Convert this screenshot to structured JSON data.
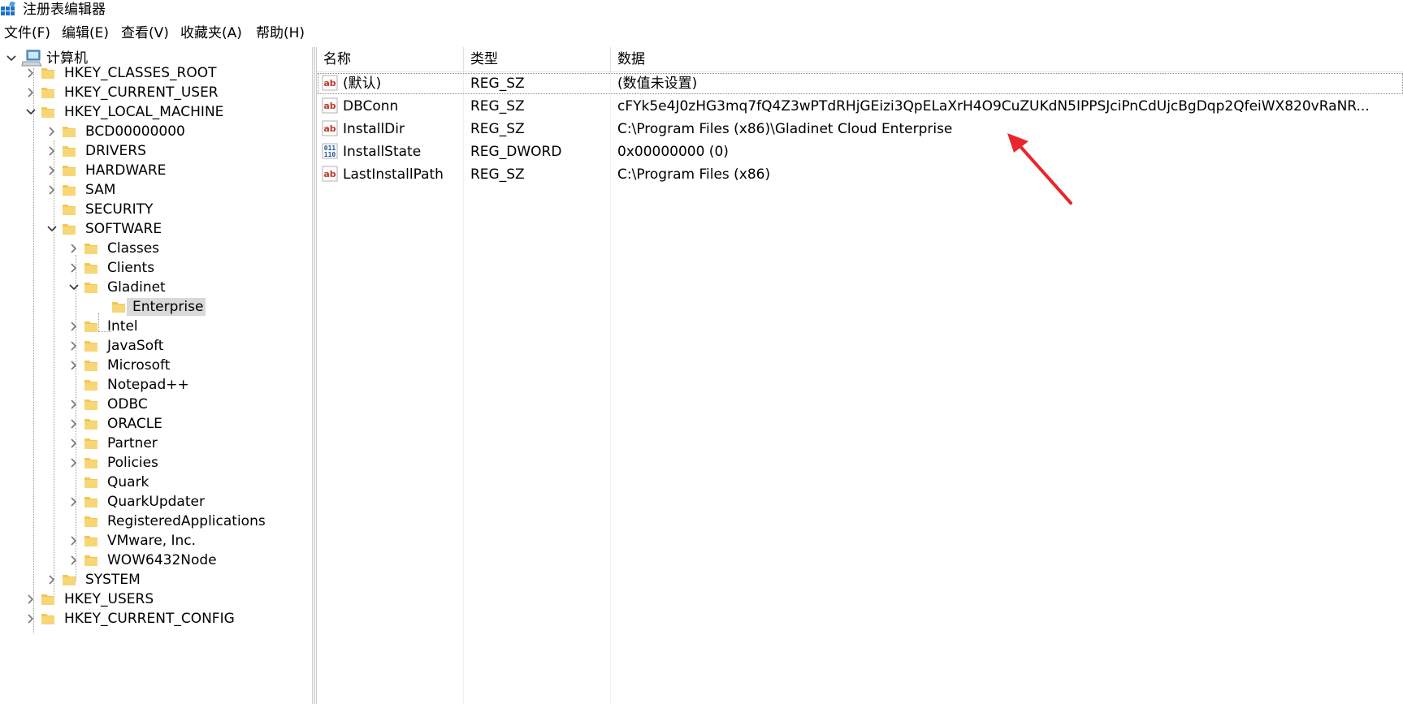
{
  "window": {
    "title": "注册表编辑器"
  },
  "menu": [
    "文件(F)",
    "编辑(E)",
    "查看(V)",
    "收藏夹(A)",
    "帮助(H)"
  ],
  "tree": {
    "root": "计算机",
    "hives": {
      "classes_root": "HKEY_CLASSES_ROOT",
      "current_user": "HKEY_CURRENT_USER",
      "local_machine": "HKEY_LOCAL_MACHINE",
      "users": "HKEY_USERS",
      "current_config": "HKEY_CURRENT_CONFIG"
    },
    "local_machine_children": [
      "BCD00000000",
      "DRIVERS",
      "HARDWARE",
      "SAM",
      "SECURITY",
      "SOFTWARE",
      "SYSTEM"
    ],
    "software_children": [
      "Classes",
      "Clients",
      "Gladinet",
      "Intel",
      "JavaSoft",
      "Microsoft",
      "Notepad++",
      "ODBC",
      "ORACLE",
      "Partner",
      "Policies",
      "Quark",
      "QuarkUpdater",
      "RegisteredApplications",
      "VMware, Inc.",
      "WOW6432Node"
    ],
    "gladinet_child": "Enterprise"
  },
  "list": {
    "headers": {
      "name": "名称",
      "type": "类型",
      "data": "数据"
    },
    "rows": [
      {
        "icon": "string-value-icon",
        "name": "(默认)",
        "type": "REG_SZ",
        "data": "(数值未设置)"
      },
      {
        "icon": "string-value-icon",
        "name": "DBConn",
        "type": "REG_SZ",
        "data": "cFYk5e4J0zHG3mq7fQ4Z3wPTdRHjGEizi3QpELaXrH4O9CuZUKdN5IPPSJciPnCdUjcBgDqp2QfeiWX820vRaNR..."
      },
      {
        "icon": "string-value-icon",
        "name": "InstallDir",
        "type": "REG_SZ",
        "data": "C:\\Program Files (x86)\\Gladinet Cloud Enterprise"
      },
      {
        "icon": "binary-value-icon",
        "name": "InstallState",
        "type": "REG_DWORD",
        "data": "0x00000000 (0)"
      },
      {
        "icon": "string-value-icon",
        "name": "LastInstallPath",
        "type": "REG_SZ",
        "data": "C:\\Program Files (x86)"
      }
    ]
  },
  "colors": {
    "annotation_arrow": "#e8262b",
    "folder": "#f3c653",
    "selection": "#d9d9d9"
  }
}
